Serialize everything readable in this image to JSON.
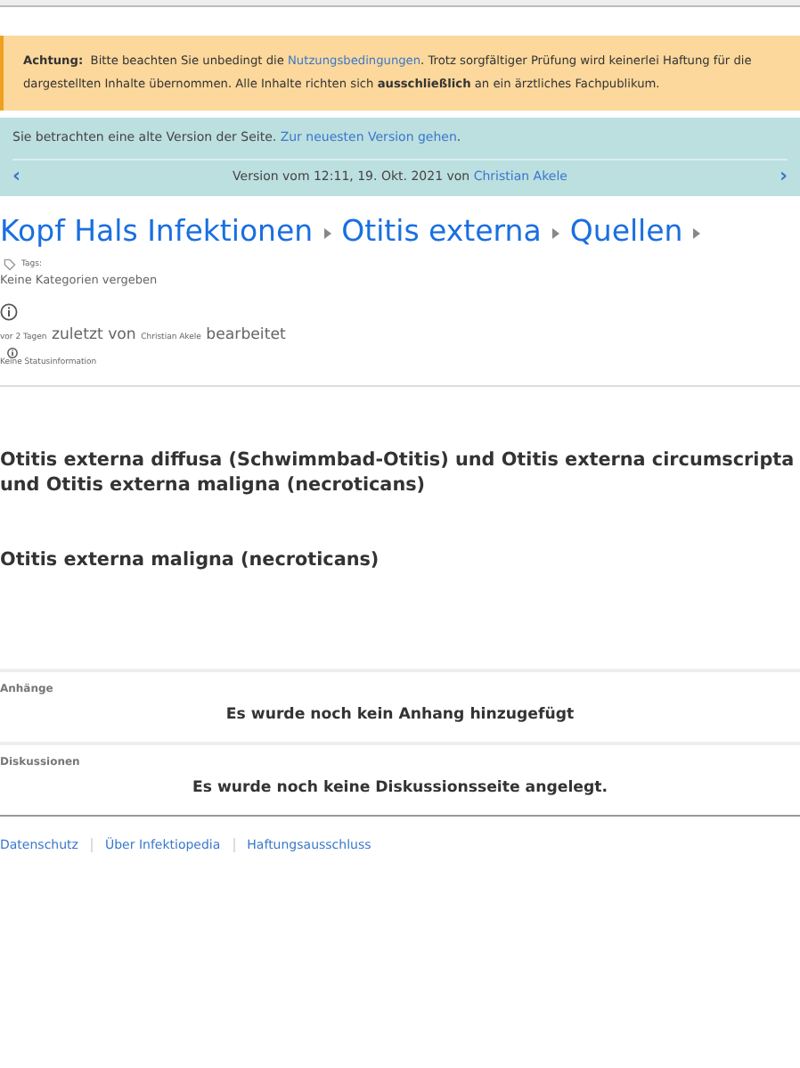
{
  "notice": {
    "label": "Achtung:",
    "before": "Bitte beachten Sie unbedingt die",
    "link": "Nutzungsbedingungen",
    "after": ". Trotz sorgfältiger Prüfung wird keinerlei Haftung für die dargestellten Inhalte übernommen. Alle Inhalte richten sich **ausschließlich** an ein ärztliches Fachpublikum."
  },
  "version_bar": {
    "text": "Sie betrachten eine alte Version der Seite.",
    "link": "Zur neuesten Version gehen",
    "after": ".",
    "version": "Version vom 12:11, 19. Okt. 2021 von",
    "author": "Christian Akele",
    "prev": "‹",
    "next": "›"
  },
  "breadcrumbs": [
    {
      "label": "Kopf Hals Infektionen"
    },
    {
      "label": "Otitis externa"
    },
    {
      "label": "Quellen"
    }
  ],
  "tags": {
    "label": "Tags:",
    "value": "Keine Kategorien vergeben"
  },
  "edit_info": {
    "time": "vor 2 Tagen",
    "middle": "zuletzt von",
    "author": "Christian Akele",
    "end": "bearbeitet",
    "status": "Keine Statusinformation"
  },
  "headings": [
    "Otitis externa diffusa (Schwimmbad-Otitis) und Otitis externa circumscripta und Otitis externa maligna (necroticans)",
    "Otitis externa maligna (necroticans)"
  ],
  "sections": [
    {
      "title": "Anhänge",
      "message": "Es wurde noch kein Anhang hinzugefügt"
    },
    {
      "title": "Diskussionen",
      "message": "Es wurde noch keine Diskussionsseite angelegt."
    }
  ],
  "footer": [
    "Datenschutz",
    "Über Infektiopedia",
    "Haftungsausschluss"
  ]
}
